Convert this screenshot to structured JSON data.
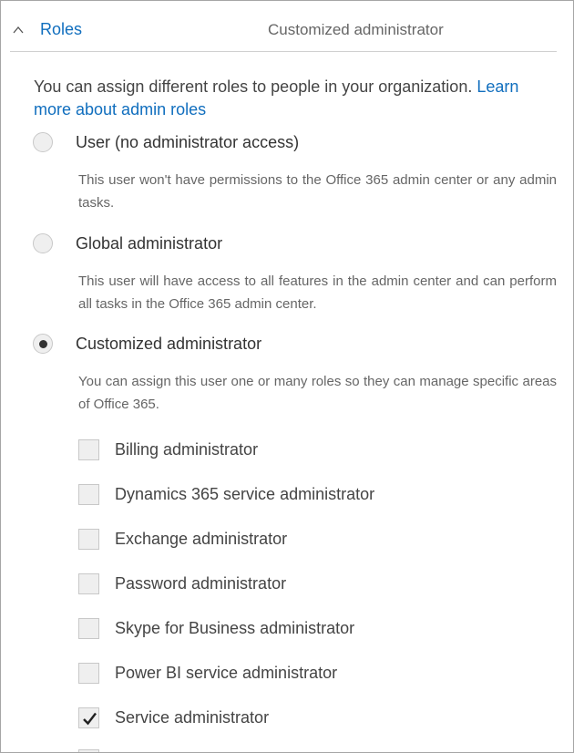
{
  "section": {
    "title": "Roles",
    "current_value": "Customized administrator"
  },
  "intro": {
    "text": "You can assign different roles to people in your organization. ",
    "link_line1": "Learn",
    "link_line2": "more about admin roles"
  },
  "roles": [
    {
      "label": "User (no administrator access)",
      "description": "This user won't have permissions to the Office 365 admin center or any admin tasks.",
      "selected": false
    },
    {
      "label": "Global administrator",
      "description": "This user will have access to all features in the admin center and can perform all tasks in the Office 365 admin center.",
      "selected": false
    },
    {
      "label": "Customized administrator",
      "description": "You can assign this user one or many roles so they can manage specific areas of Office 365.",
      "selected": true
    }
  ],
  "admin_roles": [
    {
      "label": "Billing administrator",
      "checked": false
    },
    {
      "label": "Dynamics 365 service administrator",
      "checked": false
    },
    {
      "label": "Exchange administrator",
      "checked": false
    },
    {
      "label": "Password administrator",
      "checked": false
    },
    {
      "label": "Skype for Business administrator",
      "checked": false
    },
    {
      "label": "Power BI service administrator",
      "checked": false
    },
    {
      "label": "Service administrator",
      "checked": true
    }
  ],
  "colors": {
    "link": "#106ebe",
    "border": "#a6a6a6",
    "control_fill": "#efefef"
  }
}
